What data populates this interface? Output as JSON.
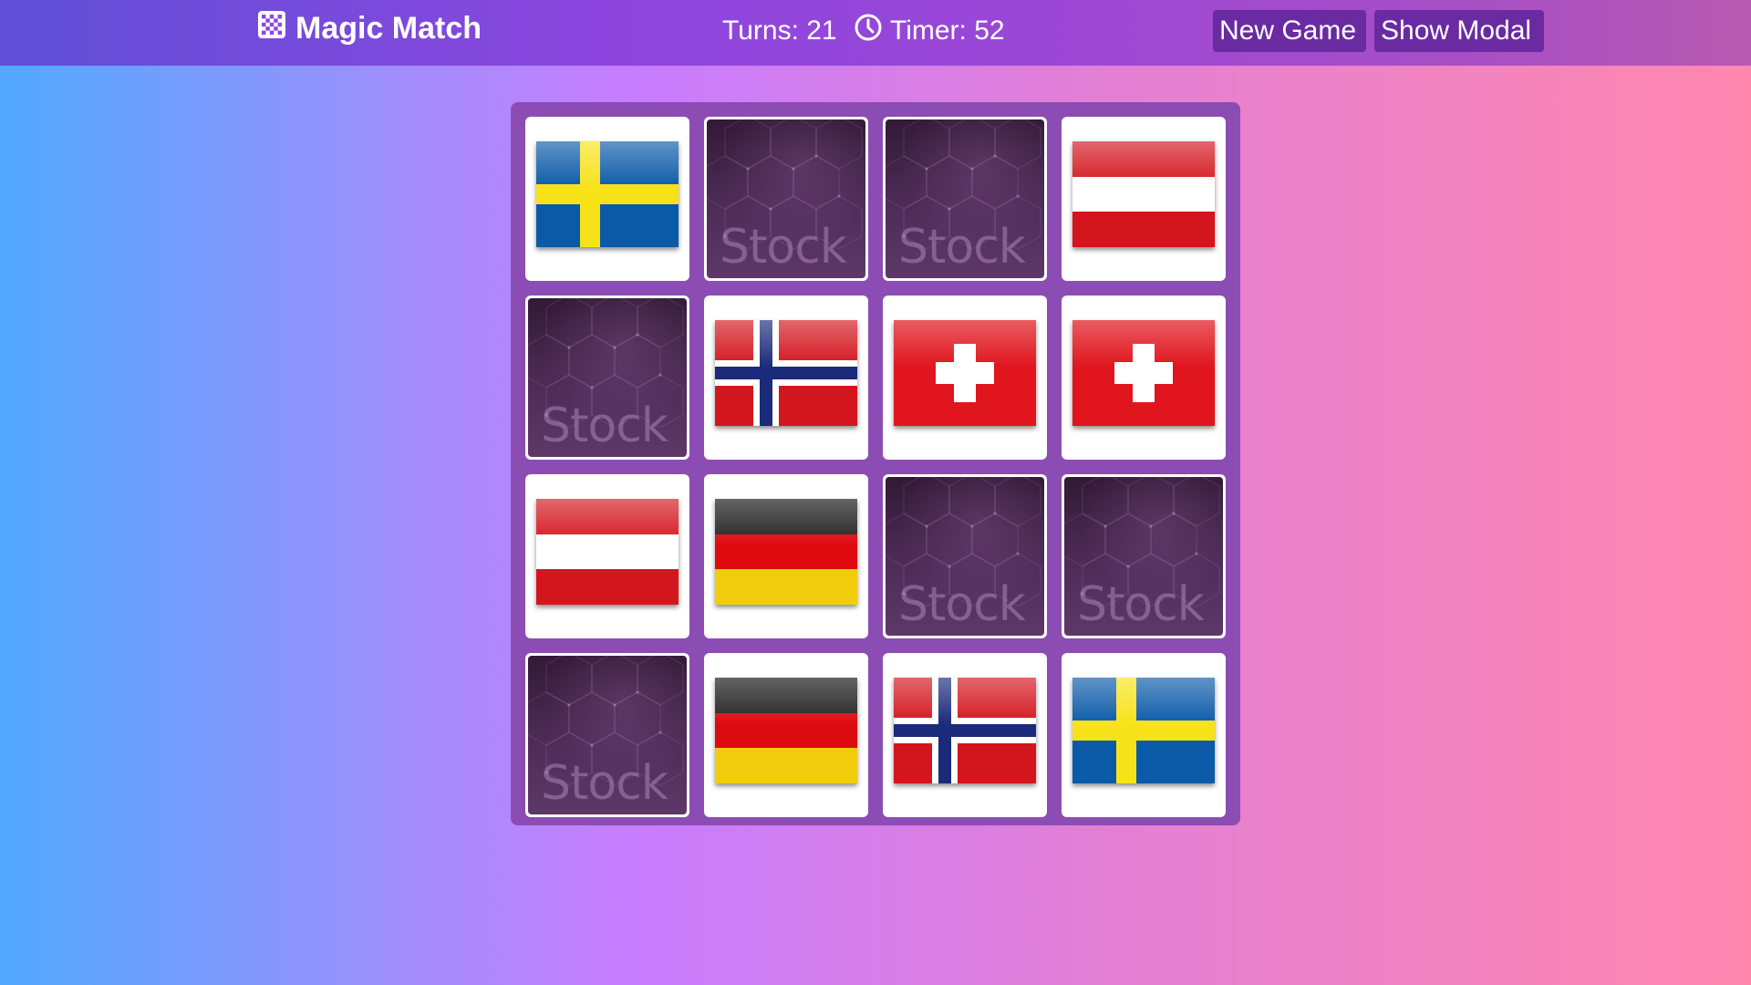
{
  "header": {
    "title": "Magic Match",
    "turns_label": "Turns: 21",
    "timer_label": "Timer: 52",
    "new_game_label": "New Game",
    "show_modal_label": "Show Modal",
    "brand_icon": "checkerboard-icon",
    "timer_icon": "clock-icon"
  },
  "board": {
    "cards": [
      {
        "state": "revealed",
        "flag": "sweden"
      },
      {
        "state": "hidden",
        "back_text": "Stock"
      },
      {
        "state": "hidden",
        "back_text": "Stock"
      },
      {
        "state": "revealed",
        "flag": "austria"
      },
      {
        "state": "hidden",
        "back_text": "Stock"
      },
      {
        "state": "revealed",
        "flag": "norway"
      },
      {
        "state": "revealed",
        "flag": "switzerland"
      },
      {
        "state": "revealed",
        "flag": "switzerland"
      },
      {
        "state": "revealed",
        "flag": "austria"
      },
      {
        "state": "revealed",
        "flag": "germany"
      },
      {
        "state": "hidden",
        "back_text": "Stock"
      },
      {
        "state": "hidden",
        "back_text": "Stock"
      },
      {
        "state": "hidden",
        "back_text": "Stock"
      },
      {
        "state": "revealed",
        "flag": "germany"
      },
      {
        "state": "revealed",
        "flag": "norway"
      },
      {
        "state": "revealed",
        "flag": "sweden"
      }
    ]
  },
  "colors": {
    "header_bg": "#8c46de",
    "button_bg": "#6a2aa2",
    "board_bg": "#8b4cb4",
    "card_back": "#4e2c57"
  }
}
